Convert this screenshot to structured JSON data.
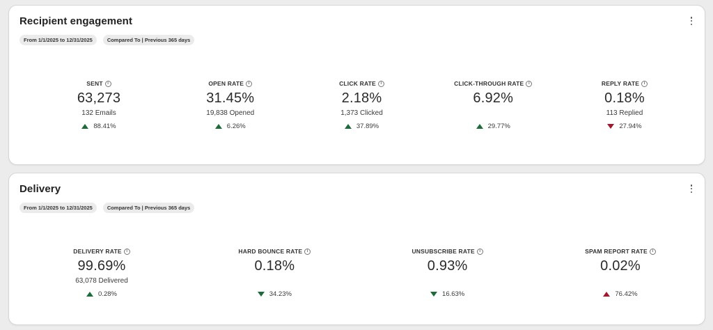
{
  "engagement": {
    "title": "Recipient engagement",
    "date_range": "From 1/1/2025 to 12/31/2025",
    "compared_to": "Compared To | Previous 365 days",
    "metrics": [
      {
        "label": "SENT",
        "value": "63,273",
        "sub": "132 Emails",
        "change": "88.41%",
        "direction": "up",
        "sentiment": "good"
      },
      {
        "label": "OPEN RATE",
        "value": "31.45%",
        "sub": "19,838 Opened",
        "change": "6.26%",
        "direction": "up",
        "sentiment": "good"
      },
      {
        "label": "CLICK RATE",
        "value": "2.18%",
        "sub": "1,373 Clicked",
        "change": "37.89%",
        "direction": "up",
        "sentiment": "good"
      },
      {
        "label": "CLICK-THROUGH RATE",
        "value": "6.92%",
        "sub": "",
        "change": "29.77%",
        "direction": "up",
        "sentiment": "good"
      },
      {
        "label": "REPLY RATE",
        "value": "0.18%",
        "sub": "113 Replied",
        "change": "27.94%",
        "direction": "down",
        "sentiment": "bad"
      }
    ]
  },
  "delivery": {
    "title": "Delivery",
    "date_range": "From 1/1/2025 to 12/31/2025",
    "compared_to": "Compared To | Previous 365 days",
    "metrics": [
      {
        "label": "DELIVERY RATE",
        "value": "99.69%",
        "sub": "63,078 Delivered",
        "change": "0.28%",
        "direction": "up",
        "sentiment": "good"
      },
      {
        "label": "HARD BOUNCE RATE",
        "value": "0.18%",
        "sub": "",
        "change": "34.23%",
        "direction": "down",
        "sentiment": "good"
      },
      {
        "label": "UNSUBSCRIBE RATE",
        "value": "0.93%",
        "sub": "",
        "change": "16.63%",
        "direction": "down",
        "sentiment": "good"
      },
      {
        "label": "SPAM REPORT RATE",
        "value": "0.02%",
        "sub": "",
        "change": "76.42%",
        "direction": "up",
        "sentiment": "bad"
      }
    ]
  },
  "icons": {
    "info": "info-icon",
    "menu": "more-vertical-icon",
    "up": "triangle-up-icon",
    "down": "triangle-down-icon"
  },
  "colors": {
    "positive": "#1e6b3a",
    "negative": "#a0182c"
  }
}
